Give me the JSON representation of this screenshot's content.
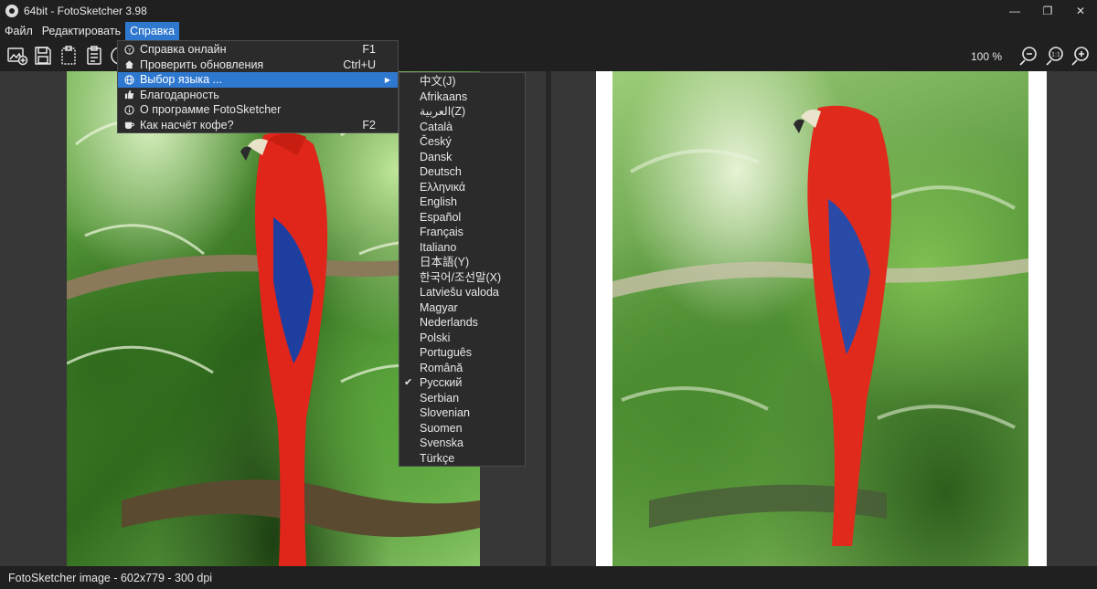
{
  "window": {
    "title": "64bit - FotoSketcher 3.98"
  },
  "window_controls": {
    "minimize": "—",
    "maximize": "❐",
    "close": "✕"
  },
  "menubar": {
    "file": "Файл",
    "edit": "Редактировать",
    "help": "Справка"
  },
  "toolbar": {
    "zoom": "100 %"
  },
  "help_menu": {
    "items": [
      {
        "label": "Справка онлайн",
        "shortcut": "F1",
        "icon": "help-circle-icon"
      },
      {
        "label": "Проверить обновления",
        "shortcut": "Ctrl+U",
        "icon": "home-icon"
      },
      {
        "label": "Выбор языка ...",
        "shortcut": "",
        "icon": "globe-icon"
      },
      {
        "label": "Благодарность",
        "shortcut": "",
        "icon": "thumbs-up-icon"
      },
      {
        "label": "О программе FotoSketcher",
        "shortcut": "",
        "icon": "info-icon"
      },
      {
        "label": "Как насчёт кофе?",
        "shortcut": "F2",
        "icon": "coffee-icon"
      }
    ]
  },
  "language_menu": {
    "items": [
      "中文(J)",
      "Afrikaans",
      "العربية(Z)",
      "Català",
      "Český",
      "Dansk",
      "Deutsch",
      "Ελληνικά",
      "English",
      "Español",
      "Français",
      "Italiano",
      "日本語(Y)",
      "한국어/조선말(X)",
      "Latviešu valoda",
      "Magyar",
      "Nederlands",
      "Polski",
      "Português",
      "Română",
      "Русский",
      "Serbian",
      "Slovenian",
      "Suomen",
      "Svenska",
      "Türkçe"
    ],
    "checked": "Русский"
  },
  "statusbar": {
    "text": "FotoSketcher image - 602x779 - 300 dpi"
  },
  "colors": {
    "accent": "#2f78d0",
    "background": "#202020",
    "menu_bg": "#2b2b2b"
  }
}
